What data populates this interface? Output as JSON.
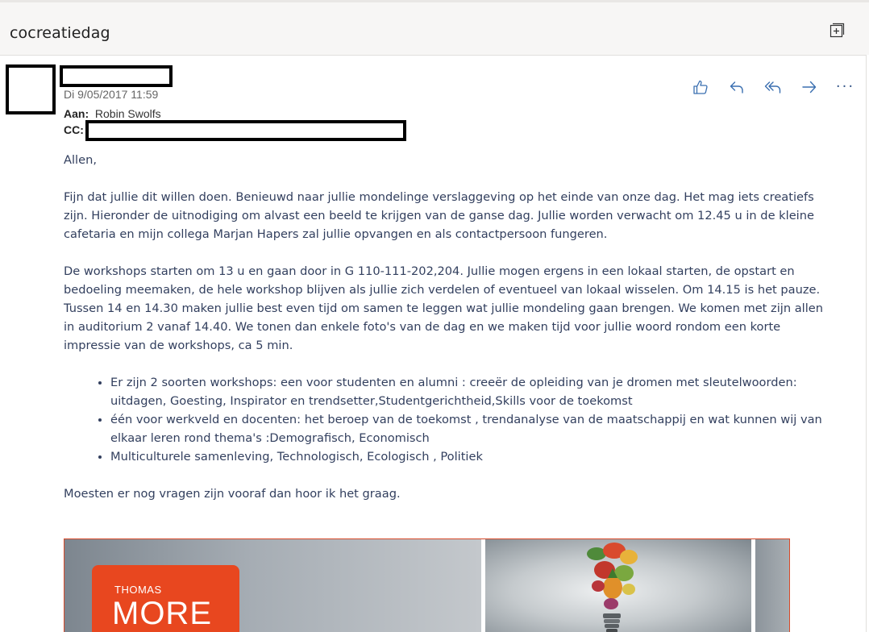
{
  "header": {
    "subject": "cocreatiedag"
  },
  "message": {
    "date": "Di 9/05/2017 11:59",
    "to_label": "Aan:",
    "to_value": "Robin Swolfs",
    "cc_label": "CC:"
  },
  "body": {
    "greeting": "Allen,",
    "para1": "Fijn dat jullie dit willen doen. Benieuwd naar jullie mondelinge verslaggeving op het einde van onze dag. Het mag iets creatiefs zijn.  Hieronder de uitnodiging om alvast een beeld te krijgen van de ganse dag. Jullie worden verwacht om 12.45 u in de kleine cafetaria en mijn collega Marjan Hapers zal jullie opvangen en als contactpersoon fungeren.",
    "para2": "De workshops starten om 13 u  en gaan door in G 110-111-202,204. Jullie mogen ergens in een lokaal starten, de opstart en bedoeling meemaken, de hele workshop blijven als jullie zich verdelen of eventueel van lokaal wisselen. Om 14.15 is het pauze. Tussen 14 en 14.30 maken jullie best even tijd om samen te leggen wat jullie mondeling gaan brengen. We komen met zijn allen in auditorium 2 vanaf 14.40. We tonen dan enkele foto's van de dag en we maken tijd voor jullie woord rondom een korte impressie van de workshops, ca 5 min.",
    "bullets": [
      "Er zijn 2 soorten workshops: een voor studenten en alumni : creeër de opleiding van je dromen  met sleutelwoorden: uitdagen, Goesting, Inspirator en trendsetter,Studentgerichtheid,Skills voor de toekomst",
      "één voor werkveld en docenten: het beroep van de toekomst , trendanalyse van de maatschappij en wat kunnen wij van elkaar leren rond thema's :Demografisch, Economisch",
      "Multiculturele samenleving, Technologisch, Ecologisch , Politiek"
    ],
    "closing": "Moesten er nog vragen zijn vooraf dan hoor ik het graag."
  },
  "banner": {
    "logo_small": "THOMAS",
    "logo_big": "MORE"
  },
  "icons": {
    "popout": "popout-icon",
    "like": "like-icon",
    "reply": "reply-icon",
    "reply_all": "reply-all-icon",
    "forward": "forward-icon",
    "more": "more-icon"
  },
  "colors": {
    "accent": "#3a6fb0",
    "body_text": "#323f5e",
    "brand_orange": "#e8471f"
  }
}
